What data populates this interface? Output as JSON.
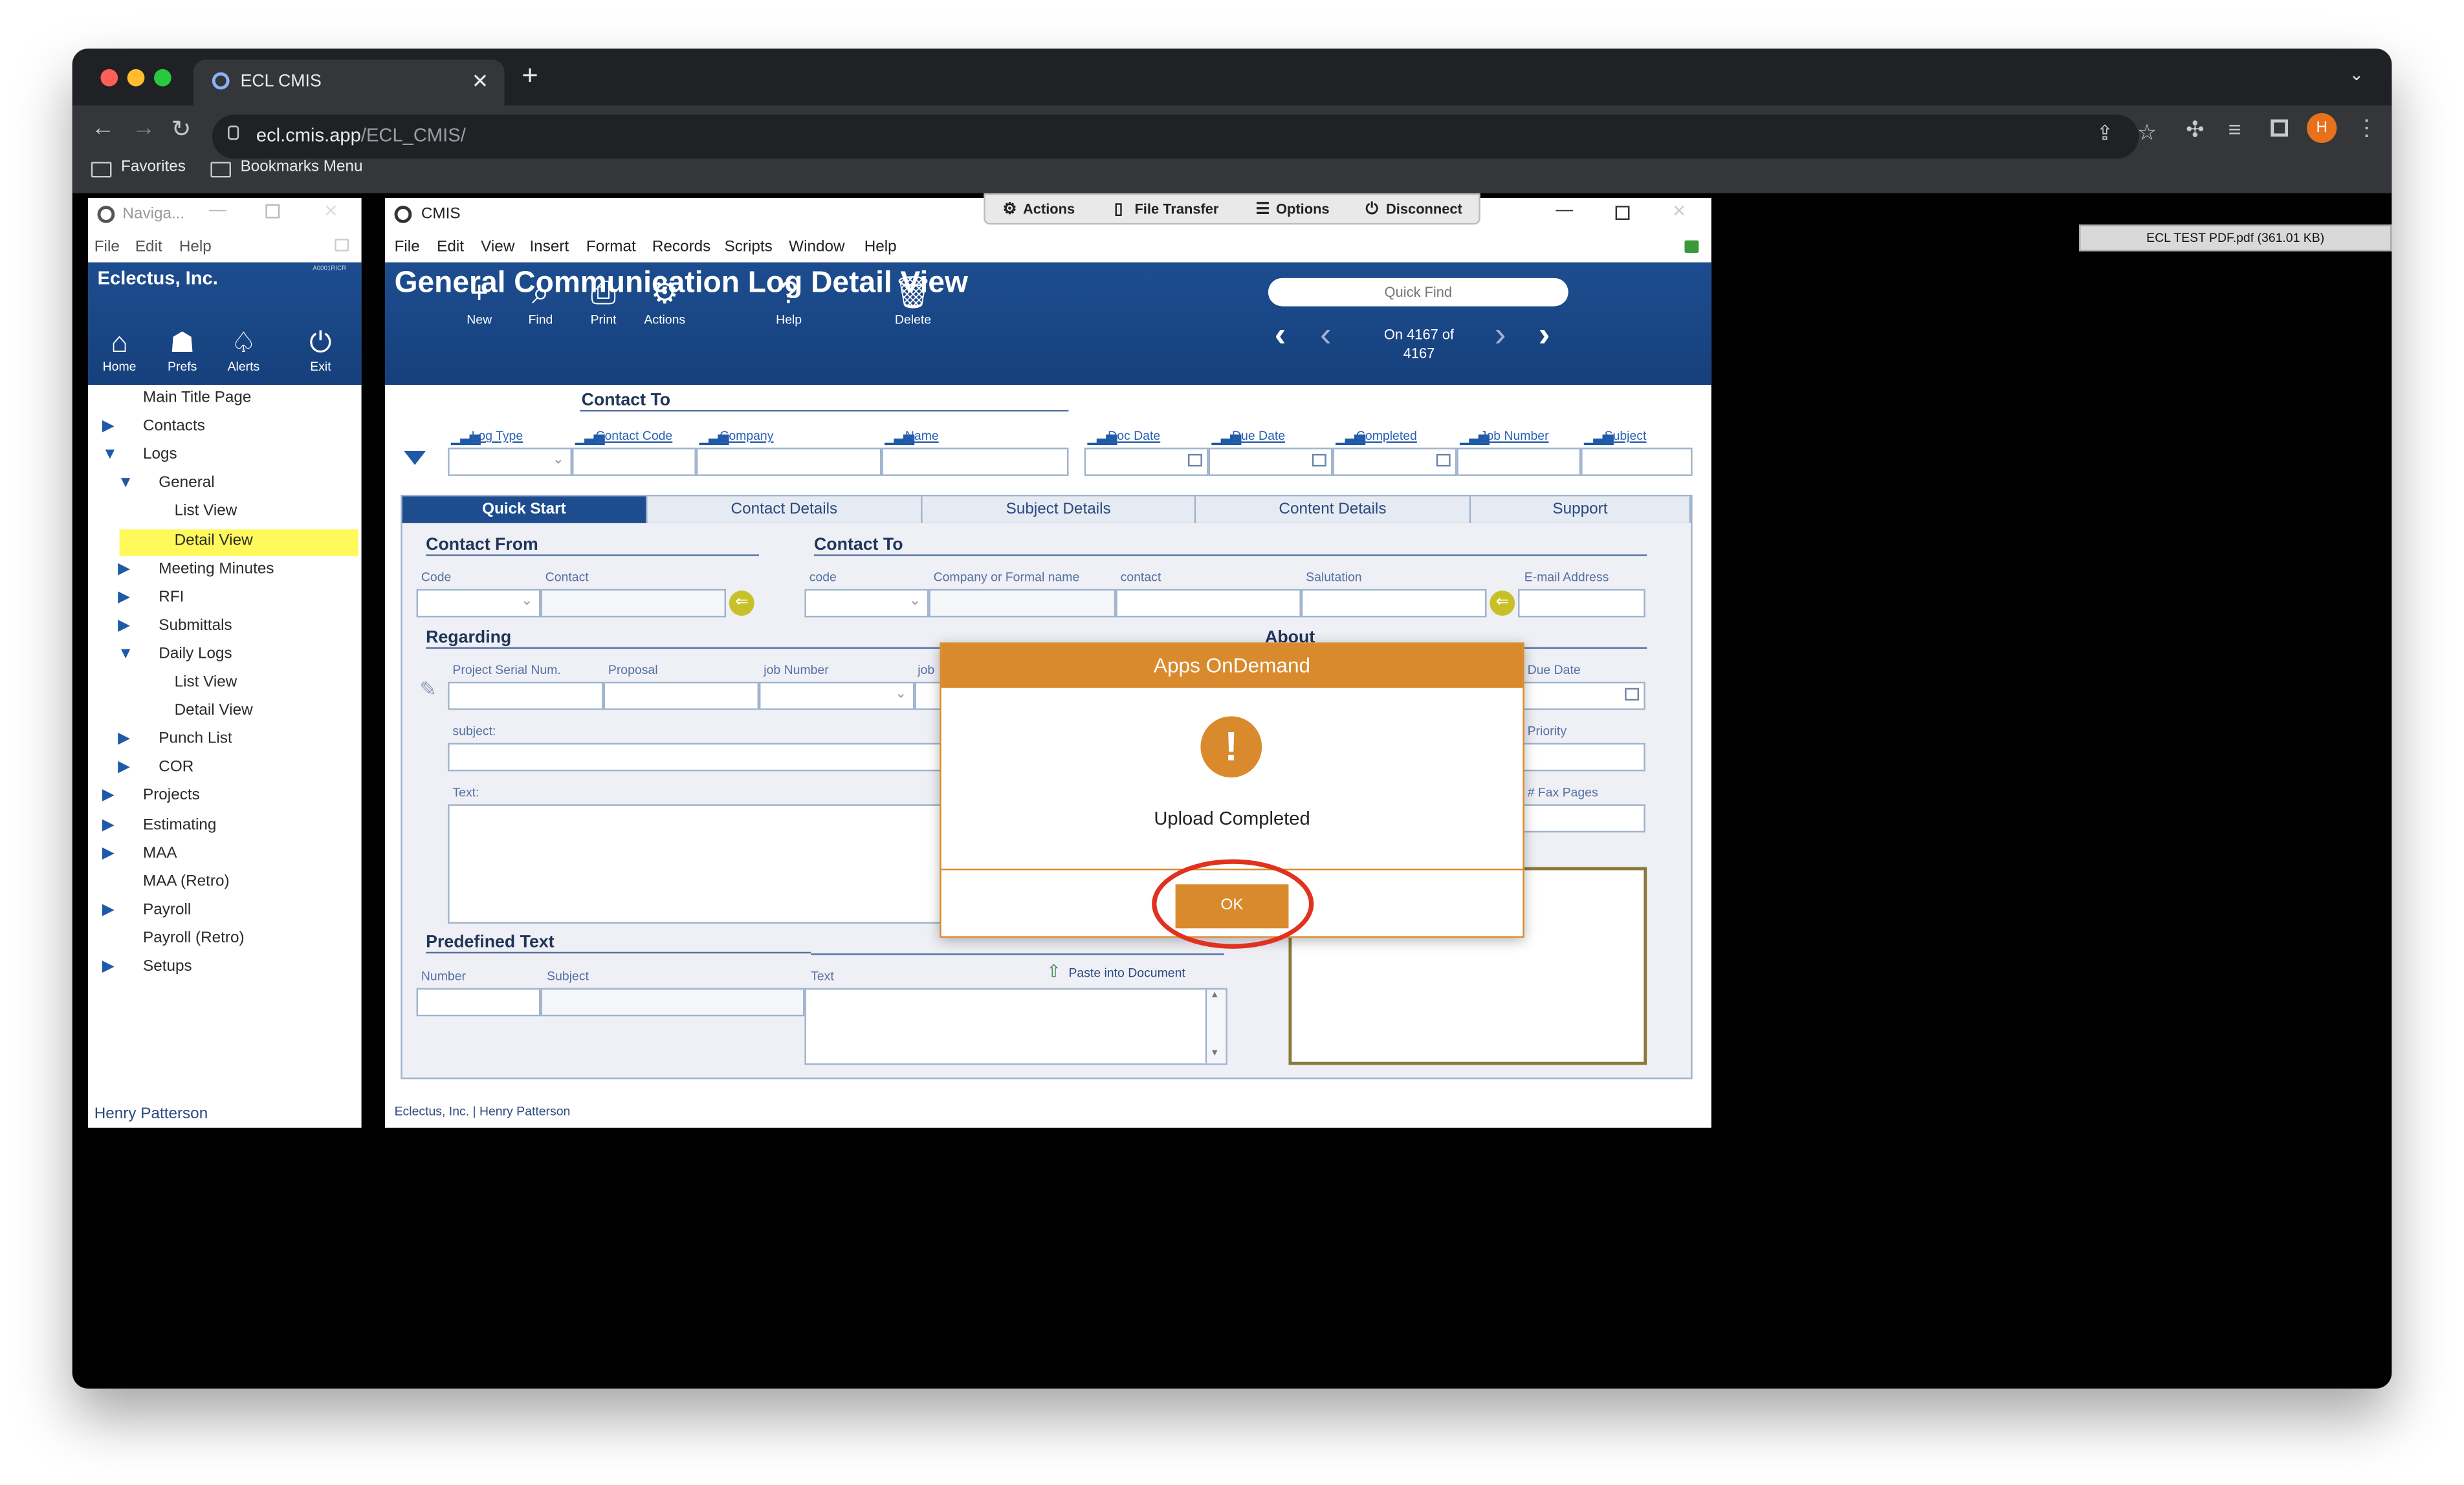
{
  "browser": {
    "tab_title": "ECL CMIS",
    "url_domain": "ecl.cmis.app",
    "url_path": "/ECL_CMIS/",
    "bookmarks": [
      "Favorites",
      "Bookmarks Menu"
    ],
    "profile_initial": "H",
    "colors": {
      "frame": "#202124",
      "toolbar": "#35363a",
      "profile": "#e8711c"
    }
  },
  "download_bar": {
    "text": "ECL TEST PDF.pdf (361.01 KB)"
  },
  "nav_window": {
    "title": "Naviga...",
    "menu": [
      "File",
      "Edit",
      "Help"
    ],
    "company": "Eclectus, Inc.",
    "company_code": "A0001RICR",
    "icons": [
      {
        "label": "Home",
        "icon": "home-icon"
      },
      {
        "label": "Prefs",
        "icon": "prefs-icon"
      },
      {
        "label": "Alerts",
        "icon": "alerts-icon"
      },
      {
        "label": "Exit",
        "icon": "power-icon"
      }
    ],
    "tree": [
      {
        "label": "Main Title Page",
        "level": 0,
        "arrow": "none"
      },
      {
        "label": "Contacts",
        "level": 0,
        "arrow": "right"
      },
      {
        "label": "Logs",
        "level": 0,
        "arrow": "down"
      },
      {
        "label": "General",
        "level": 1,
        "arrow": "down"
      },
      {
        "label": "List View",
        "level": 2,
        "arrow": "none"
      },
      {
        "label": "Detail View",
        "level": 2,
        "arrow": "none",
        "selected": true
      },
      {
        "label": "Meeting Minutes",
        "level": 1,
        "arrow": "right"
      },
      {
        "label": "RFI",
        "level": 1,
        "arrow": "right"
      },
      {
        "label": "Submittals",
        "level": 1,
        "arrow": "right"
      },
      {
        "label": "Daily Logs",
        "level": 1,
        "arrow": "down"
      },
      {
        "label": "List View",
        "level": 2,
        "arrow": "none"
      },
      {
        "label": "Detail View",
        "level": 2,
        "arrow": "none"
      },
      {
        "label": "Punch List",
        "level": 1,
        "arrow": "right"
      },
      {
        "label": "COR",
        "level": 1,
        "arrow": "right"
      },
      {
        "label": "Projects",
        "level": 0,
        "arrow": "right"
      },
      {
        "label": "Estimating",
        "level": 0,
        "arrow": "right"
      },
      {
        "label": "MAA",
        "level": 0,
        "arrow": "right"
      },
      {
        "label": "MAA (Retro)",
        "level": 0,
        "arrow": "none"
      },
      {
        "label": "Payroll",
        "level": 0,
        "arrow": "right"
      },
      {
        "label": "Payroll (Retro)",
        "level": 0,
        "arrow": "none"
      },
      {
        "label": "Setups",
        "level": 0,
        "arrow": "right"
      }
    ],
    "user": "Henry Patterson",
    "selected_color": "#fff95b"
  },
  "cmis_window": {
    "title": "CMIS",
    "topbar": [
      "Actions",
      "File Transfer",
      "Options",
      "Disconnect"
    ],
    "menu": [
      "File",
      "Edit",
      "View",
      "Insert",
      "Format",
      "Records",
      "Scripts",
      "Window",
      "Help"
    ],
    "header_title": "General Communication Log Detail View",
    "quick_find_placeholder": "Quick Find",
    "toolbar": [
      "New",
      "Find",
      "Print",
      "Actions",
      "Help",
      "Delete"
    ],
    "record_counter": "On 4167 of 4167",
    "contact_to_header": "Contact To",
    "sort_columns": [
      "Log Type",
      "Contact Code",
      "Company",
      "Name",
      "Doc Date",
      "Due Date",
      "Completed",
      "Job Number",
      "Subject"
    ],
    "tabs": [
      "Quick Start",
      "Contact Details",
      "Subject Details",
      "Content Details",
      "Support"
    ],
    "active_tab": 0,
    "sections": {
      "contact_from": "Contact From",
      "contact_to": "Contact To",
      "regarding": "Regarding",
      "about": "About",
      "predefined_text": "Predefined Text"
    },
    "labels": {
      "code": "Code",
      "contact": "Contact",
      "code_lower": "code",
      "company_formal": "Company or Formal name",
      "contact_lower": "contact",
      "salutation": "Salutation",
      "email": "E-mail Address",
      "project_serial": "Project Serial Num.",
      "proposal": "Proposal",
      "job_number": "job Number",
      "job_short": "job",
      "due_date": "Due Date",
      "subject": "subject:",
      "priority": "Priority",
      "text": "Text:",
      "fax_pages": "# Fax Pages",
      "number": "Number",
      "subject2": "Subject",
      "text2": "Text",
      "paste": "Paste into Document"
    },
    "footer": "Eclectus, Inc. | Henry Patterson"
  },
  "dialog": {
    "title": "Apps OnDemand",
    "message": "Upload Completed",
    "ok_label": "OK",
    "accent": "#d98a2c",
    "highlight": "#e0321e"
  }
}
